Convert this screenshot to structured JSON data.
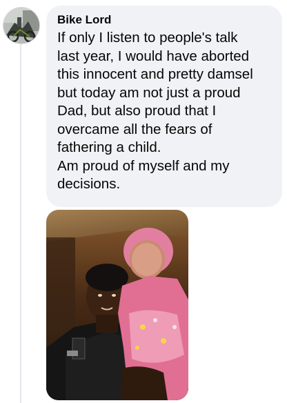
{
  "comment": {
    "author": "Bike Lord",
    "lines": [
      "If only I listen to people's talk",
      "last year, I would have aborted",
      "this innocent and pretty damsel",
      "but today am not just a proud",
      "Dad, but also proud that I",
      "overcame all the fears of",
      "fathering a child.",
      "Am proud of myself and my",
      "decisions."
    ],
    "bubble_color": "#f0f2f5",
    "text_color": "#050505"
  },
  "attachment": {
    "type": "photo"
  }
}
